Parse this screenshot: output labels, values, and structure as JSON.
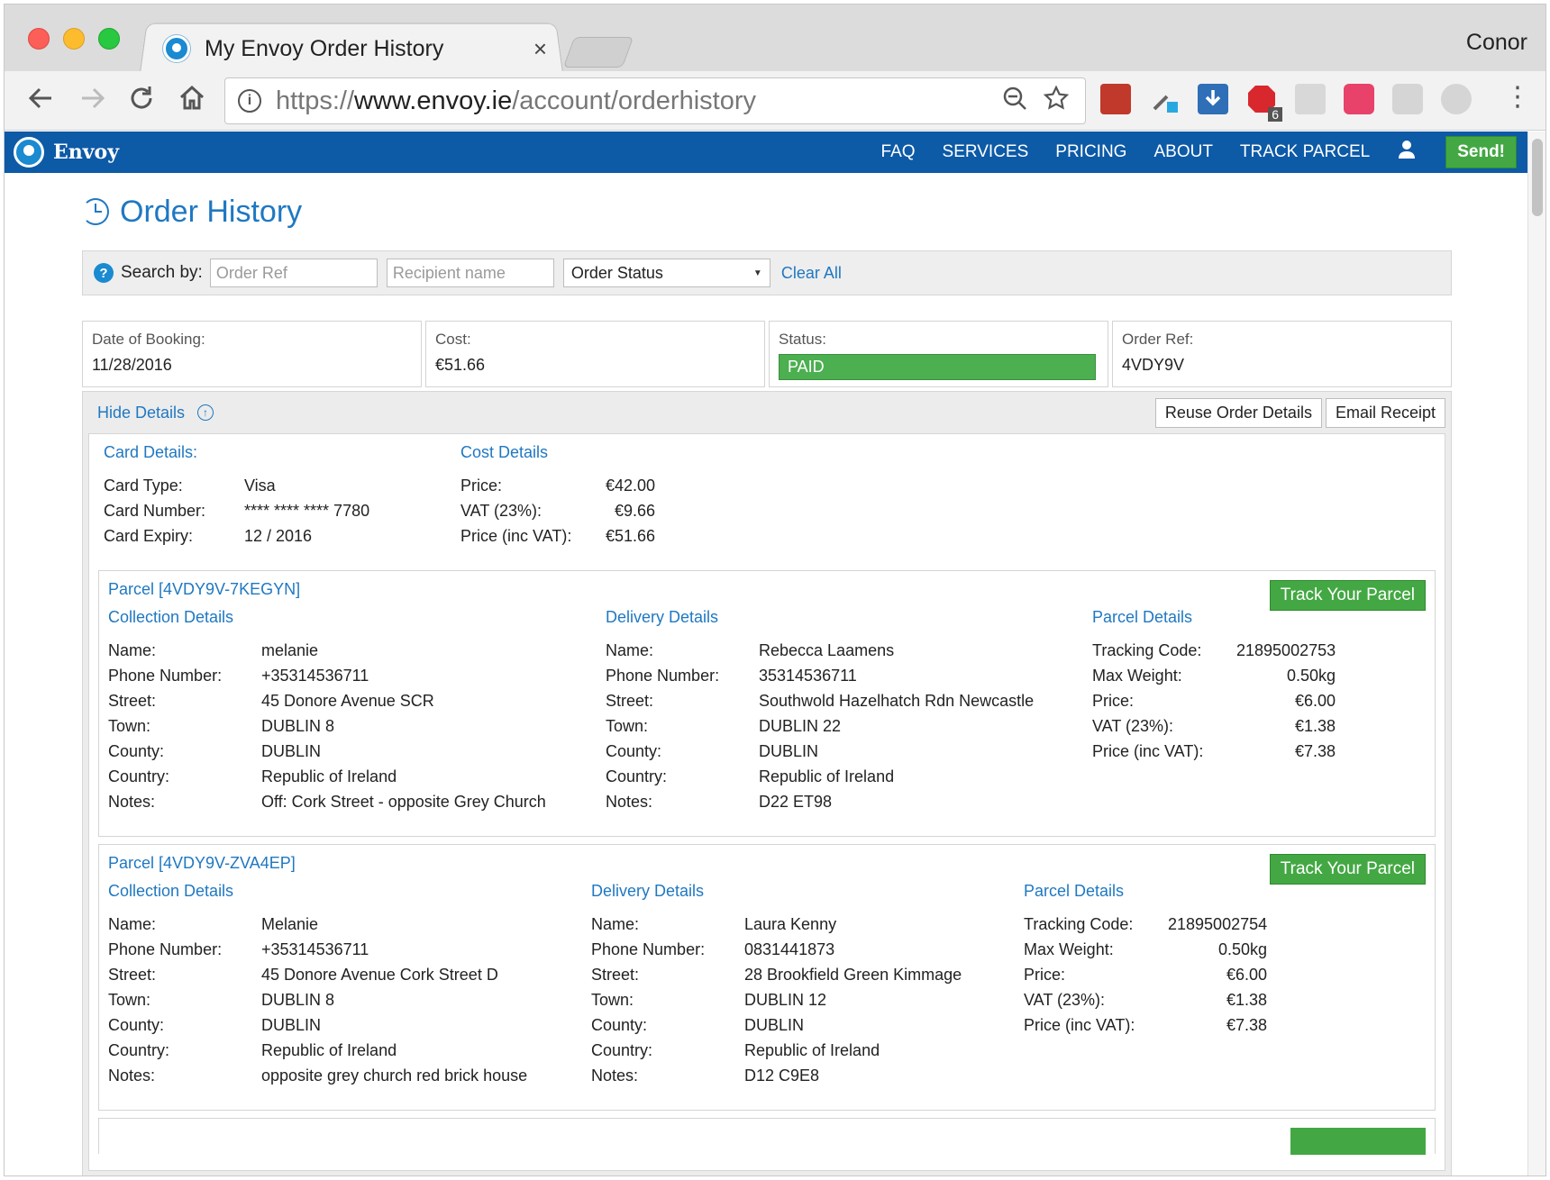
{
  "browser": {
    "tab_title": "My Envoy Order History",
    "tab_close": "×",
    "profile_name": "Conor",
    "url_scheme": "https://",
    "url_host": "www.envoy.ie",
    "url_path": "/account/orderhistory",
    "ext_badge": "6"
  },
  "nav": {
    "brand": "Envoy",
    "links": [
      "FAQ",
      "SERVICES",
      "PRICING",
      "ABOUT",
      "TRACK PARCEL"
    ],
    "send_label": "Send!"
  },
  "page": {
    "title": "Order History"
  },
  "search": {
    "label": "Search by:",
    "order_ref_placeholder": "Order Ref",
    "recipient_placeholder": "Recipient name",
    "status_selected": "Order Status",
    "clear_all": "Clear All"
  },
  "summary": {
    "date_label": "Date of Booking:",
    "date_value": "11/28/2016",
    "cost_label": "Cost:",
    "cost_value": "€51.66",
    "status_label": "Status:",
    "status_value": "PAID",
    "ref_label": "Order Ref:",
    "ref_value": "4VDY9V"
  },
  "details": {
    "hide_label": "Hide Details",
    "reuse_label": "Reuse Order Details",
    "email_label": "Email Receipt",
    "card_heading": "Card Details:",
    "card": [
      {
        "k": "Card Type:",
        "v": "Visa"
      },
      {
        "k": "Card Number:",
        "v": "**** **** **** 7780"
      },
      {
        "k": "Card Expiry:",
        "v": "12 / 2016"
      }
    ],
    "cost_heading": "Cost Details",
    "cost": [
      {
        "k": "Price:",
        "v": "€42.00"
      },
      {
        "k": "VAT (23%):",
        "v": "€9.66"
      },
      {
        "k": "Price (inc VAT):",
        "v": "€51.66"
      }
    ]
  },
  "parcels": [
    {
      "title": "Parcel [4VDY9V-7KEGYN]",
      "track_label": "Track Your Parcel",
      "collection_heading": "Collection Details",
      "delivery_heading": "Delivery Details",
      "parcel_heading": "Parcel Details",
      "collection": [
        {
          "k": "Name:",
          "v": "melanie"
        },
        {
          "k": "Phone Number:",
          "v": "+35314536711"
        },
        {
          "k": "Street:",
          "v": "45 Donore Avenue SCR"
        },
        {
          "k": "Town:",
          "v": "DUBLIN 8"
        },
        {
          "k": "County:",
          "v": "DUBLIN"
        },
        {
          "k": "Country:",
          "v": "Republic of Ireland"
        },
        {
          "k": "Notes:",
          "v": "Off: Cork Street - opposite Grey Church"
        }
      ],
      "delivery": [
        {
          "k": "Name:",
          "v": "Rebecca Laamens"
        },
        {
          "k": "Phone Number:",
          "v": "35314536711"
        },
        {
          "k": "Street:",
          "v": "Southwold Hazelhatch Rdn Newcastle"
        },
        {
          "k": "Town:",
          "v": "DUBLIN 22"
        },
        {
          "k": "County:",
          "v": "DUBLIN"
        },
        {
          "k": "Country:",
          "v": "Republic of Ireland"
        },
        {
          "k": "Notes:",
          "v": "D22 ET98"
        }
      ],
      "parcel": [
        {
          "k": "Tracking Code:",
          "v": "21895002753"
        },
        {
          "k": "Max Weight:",
          "v": "0.50kg"
        },
        {
          "k": "Price:",
          "v": "€6.00"
        },
        {
          "k": "VAT (23%):",
          "v": "€1.38"
        },
        {
          "k": "Price (inc VAT):",
          "v": "€7.38"
        }
      ]
    },
    {
      "title": "Parcel [4VDY9V-ZVA4EP]",
      "track_label": "Track Your Parcel",
      "collection_heading": "Collection Details",
      "delivery_heading": "Delivery Details",
      "parcel_heading": "Parcel Details",
      "collection": [
        {
          "k": "Name:",
          "v": "Melanie"
        },
        {
          "k": "Phone Number:",
          "v": "+35314536711"
        },
        {
          "k": "Street:",
          "v": "45 Donore Avenue Cork Street D"
        },
        {
          "k": "Town:",
          "v": "DUBLIN 8"
        },
        {
          "k": "County:",
          "v": "DUBLIN"
        },
        {
          "k": "Country:",
          "v": "Republic of Ireland"
        },
        {
          "k": "Notes:",
          "v": "opposite grey church red brick house"
        }
      ],
      "delivery": [
        {
          "k": "Name:",
          "v": "Laura Kenny"
        },
        {
          "k": "Phone Number:",
          "v": "0831441873"
        },
        {
          "k": "Street:",
          "v": "28 Brookfield Green Kimmage"
        },
        {
          "k": "Town:",
          "v": "DUBLIN 12"
        },
        {
          "k": "County:",
          "v": "DUBLIN"
        },
        {
          "k": "Country:",
          "v": "Republic of Ireland"
        },
        {
          "k": "Notes:",
          "v": "D12 C9E8"
        }
      ],
      "parcel": [
        {
          "k": "Tracking Code:",
          "v": "21895002754"
        },
        {
          "k": "Max Weight:",
          "v": "0.50kg"
        },
        {
          "k": "Price:",
          "v": "€6.00"
        },
        {
          "k": "VAT (23%):",
          "v": "€1.38"
        },
        {
          "k": "Price (inc VAT):",
          "v": "€7.38"
        }
      ]
    }
  ],
  "colors": {
    "nav_blue": "#0d5aa7",
    "link_blue": "#1f78c2",
    "green": "#43a843"
  }
}
